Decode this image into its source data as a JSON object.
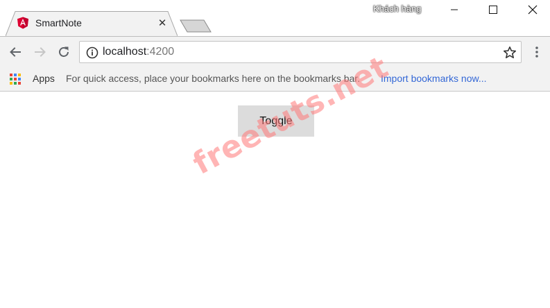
{
  "browser": {
    "profile_name": "Khách hàng",
    "tabs": [
      {
        "title": "SmartNote",
        "favicon": "angular-logo-icon",
        "active": true
      }
    ],
    "address_bar": {
      "host": "localhost",
      "port": ":4200"
    },
    "bookmarks_bar": {
      "apps_label": "Apps",
      "hint": "For quick access, place your bookmarks here on the bookmarks bar.",
      "import_link": "Import bookmarks now..."
    },
    "icons": {
      "tab_close": "close-icon",
      "back": "back-arrow-icon",
      "forward": "forward-arrow-icon",
      "reload": "reload-icon",
      "info": "info-icon",
      "bookmark": "star-icon",
      "menu": "more-vert-icon",
      "apps": "apps-grid-icon"
    },
    "colors": {
      "chrome_bg": "#f2f2f2",
      "link": "#3367d6",
      "angular_red": "#dd0031",
      "button_bg": "#dcdcdc"
    }
  },
  "page": {
    "toggle_button_label": "Toggle"
  },
  "watermark": {
    "text": "freetuts.net"
  }
}
